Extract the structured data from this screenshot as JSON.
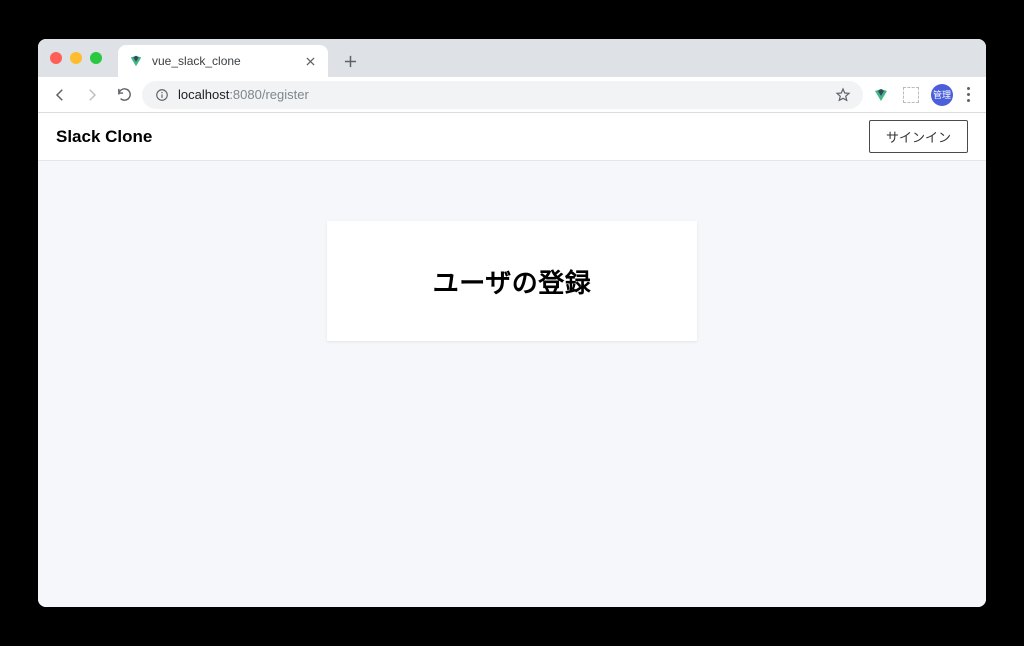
{
  "browser": {
    "tab": {
      "title": "vue_slack_clone"
    },
    "url": {
      "host": "localhost",
      "port": ":8080",
      "path": "/register"
    },
    "avatar_label": "管理"
  },
  "app": {
    "header": {
      "title": "Slack Clone",
      "signin_label": "サインイン"
    },
    "register": {
      "heading": "ユーザの登録"
    }
  }
}
